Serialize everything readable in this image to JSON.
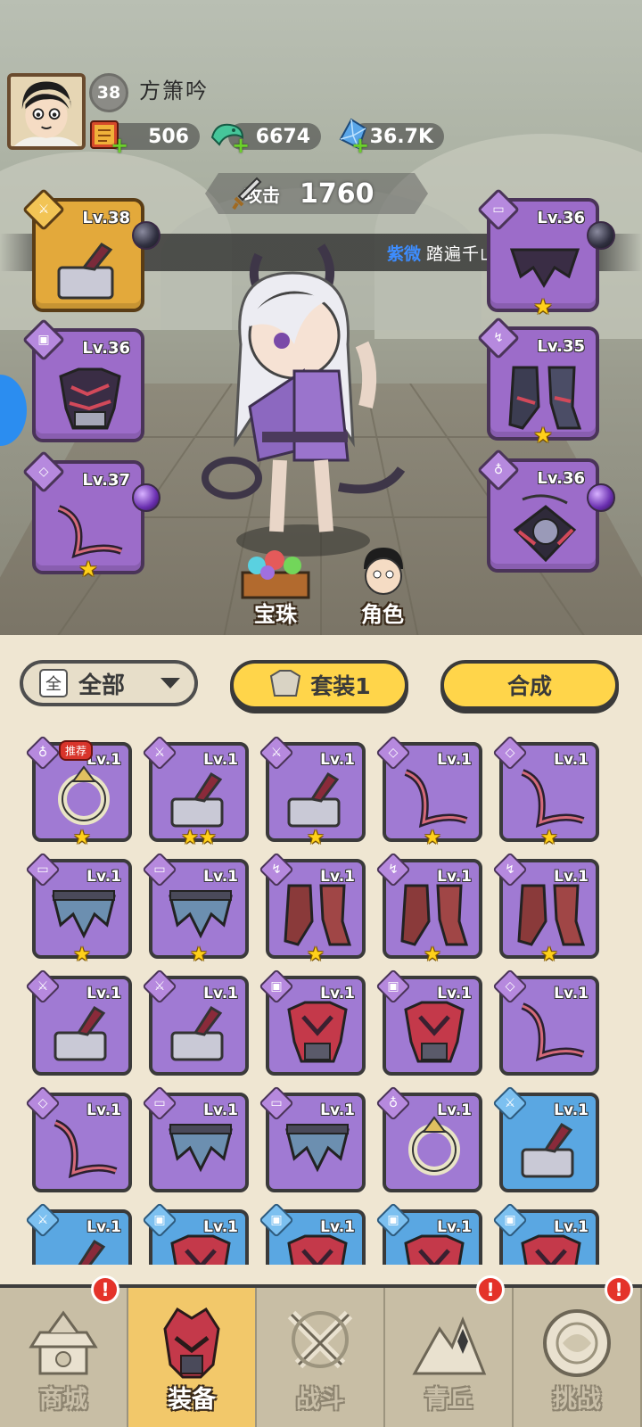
{
  "player": {
    "level": "38",
    "name": "方箫吟"
  },
  "resources": [
    {
      "icon": "gift-scroll-icon",
      "value": "506"
    },
    {
      "icon": "jade-dragon-icon",
      "value": "6674"
    },
    {
      "icon": "blue-crystal-icon",
      "value": "36.7K"
    }
  ],
  "attack": {
    "label": "攻击",
    "value": "1760"
  },
  "news": {
    "name": "紫微",
    "text": "踏遍千山，成功征服"
  },
  "equipped": [
    {
      "slot": "weapon",
      "level": "Lv.38",
      "stars": 0,
      "gem": "dark"
    },
    {
      "slot": "armor",
      "level": "Lv.36",
      "stars": 0,
      "gem": ""
    },
    {
      "slot": "belt",
      "level": "Lv.37",
      "stars": 1,
      "gem": "purple"
    },
    {
      "slot": "pants",
      "level": "Lv.36",
      "stars": 1,
      "gem": "dark"
    },
    {
      "slot": "boots",
      "level": "Lv.35",
      "stars": 1,
      "gem": ""
    },
    {
      "slot": "necklace",
      "level": "Lv.36",
      "stars": 0,
      "gem": "purple"
    }
  ],
  "side_buttons": {
    "gems": "宝珠",
    "character": "角色"
  },
  "filters": {
    "dropdown_checkbox": "全",
    "dropdown_label": "全部",
    "set_button": "套装1",
    "craft_button": "合成"
  },
  "inventory": {
    "recommend_tag": "推荐",
    "rows": [
      [
        {
          "level": "Lv.1",
          "stars": 1,
          "rarity": "purple",
          "type": "ring"
        },
        {
          "level": "Lv.1",
          "stars": 2,
          "rarity": "purple",
          "type": "weapon"
        },
        {
          "level": "Lv.1",
          "stars": 1,
          "rarity": "purple",
          "type": "weapon"
        },
        {
          "level": "Lv.1",
          "stars": 1,
          "rarity": "purple",
          "type": "belt"
        },
        {
          "level": "Lv.1",
          "stars": 1,
          "rarity": "purple",
          "type": "belt"
        }
      ],
      [
        {
          "level": "Lv.1",
          "stars": 1,
          "rarity": "purple",
          "type": "pants"
        },
        {
          "level": "Lv.1",
          "stars": 1,
          "rarity": "purple",
          "type": "pants"
        },
        {
          "level": "Lv.1",
          "stars": 1,
          "rarity": "purple",
          "type": "boots"
        },
        {
          "level": "Lv.1",
          "stars": 1,
          "rarity": "purple",
          "type": "boots"
        },
        {
          "level": "Lv.1",
          "stars": 1,
          "rarity": "purple",
          "type": "boots"
        }
      ],
      [
        {
          "level": "Lv.1",
          "stars": 0,
          "rarity": "purple",
          "type": "weapon"
        },
        {
          "level": "Lv.1",
          "stars": 0,
          "rarity": "purple",
          "type": "weapon"
        },
        {
          "level": "Lv.1",
          "stars": 0,
          "rarity": "purple",
          "type": "armor"
        },
        {
          "level": "Lv.1",
          "stars": 0,
          "rarity": "purple",
          "type": "armor"
        },
        {
          "level": "Lv.1",
          "stars": 0,
          "rarity": "purple",
          "type": "belt"
        }
      ],
      [
        {
          "level": "Lv.1",
          "stars": 0,
          "rarity": "purple",
          "type": "belt"
        },
        {
          "level": "Lv.1",
          "stars": 0,
          "rarity": "purple",
          "type": "pants"
        },
        {
          "level": "Lv.1",
          "stars": 0,
          "rarity": "purple",
          "type": "pants"
        },
        {
          "level": "Lv.1",
          "stars": 0,
          "rarity": "purple",
          "type": "ring"
        },
        {
          "level": "Lv.1",
          "stars": 0,
          "rarity": "blue",
          "type": "weapon"
        }
      ],
      [
        {
          "level": "Lv.1",
          "stars": 0,
          "rarity": "blue",
          "type": "weapon"
        },
        {
          "level": "Lv.1",
          "stars": 0,
          "rarity": "blue",
          "type": "armor"
        },
        {
          "level": "Lv.1",
          "stars": 0,
          "rarity": "blue",
          "type": "armor"
        },
        {
          "level": "Lv.1",
          "stars": 0,
          "rarity": "blue",
          "type": "armor"
        },
        {
          "level": "Lv.1",
          "stars": 0,
          "rarity": "blue",
          "type": "armor"
        }
      ]
    ]
  },
  "nav": [
    {
      "label": "商城",
      "icon": "shop-pagoda-icon",
      "alert": "!",
      "active": false
    },
    {
      "label": "装备",
      "icon": "equipment-helmet-icon",
      "alert": "",
      "active": true
    },
    {
      "label": "战斗",
      "icon": "crossed-swords-icon",
      "alert": "",
      "active": false
    },
    {
      "label": "青丘",
      "icon": "mountain-icon",
      "alert": "!",
      "active": false
    },
    {
      "label": "挑战",
      "icon": "challenge-disc-icon",
      "alert": "!",
      "active": false
    }
  ],
  "colors": {
    "rarity_purple": "#a07ad3",
    "rarity_blue": "#5aa7e2",
    "rarity_gold": "#e3a93b",
    "accent_yellow": "#ffd54a",
    "star": "#ffd01a",
    "news_name": "#3d8dff",
    "alert_red": "#e4332a"
  }
}
